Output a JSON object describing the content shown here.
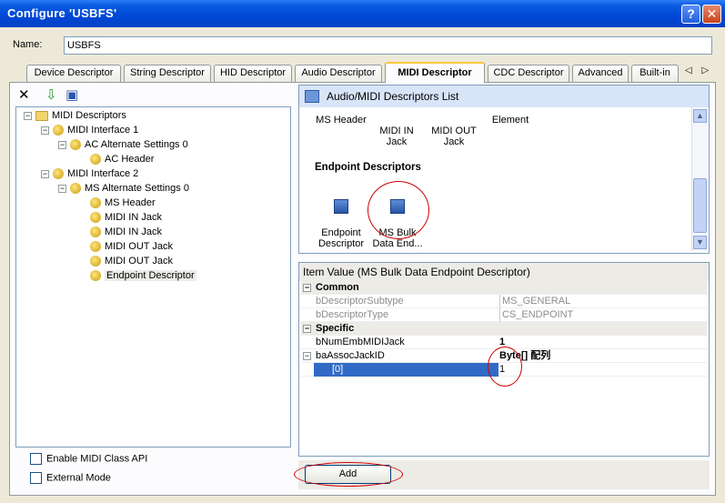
{
  "window": {
    "title": "Configure 'USBFS'",
    "help": "?",
    "close": "✕"
  },
  "name": {
    "label": "Name:",
    "value": "USBFS"
  },
  "tabs": [
    "Device Descriptor",
    "String Descriptor",
    "HID Descriptor",
    "Audio Descriptor",
    "MIDI Descriptor",
    "CDC Descriptor",
    "Advanced",
    "Built-in"
  ],
  "tab_arrows": "◁ ▷",
  "tree": {
    "nodes": [
      {
        "label": "MIDI Descriptors",
        "exp": "−"
      },
      {
        "label": "MIDI Interface 1",
        "exp": "−"
      },
      {
        "label": "AC Alternate Settings 0",
        "exp": "−"
      },
      {
        "label": "AC Header"
      },
      {
        "label": "MIDI Interface 2",
        "exp": "−"
      },
      {
        "label": "MS Alternate Settings 0",
        "exp": "−"
      },
      {
        "label": "MS Header"
      },
      {
        "label": "MIDI IN Jack"
      },
      {
        "label": "MIDI IN Jack"
      },
      {
        "label": "MIDI OUT Jack"
      },
      {
        "label": "MIDI OUT Jack"
      },
      {
        "label": "Endpoint Descriptor"
      }
    ]
  },
  "options": {
    "enable_midi_class_api": "Enable MIDI Class API",
    "external_mode": "External Mode"
  },
  "descriptors_list": {
    "title": "Audio/MIDI Descriptors List",
    "items_row1": [
      "MS Header",
      "MIDI IN\nJack",
      "MIDI OUT\nJack",
      "Element"
    ],
    "section": "Endpoint Descriptors",
    "items_row2": [
      "Endpoint\nDescriptor",
      "MS Bulk\nData End..."
    ]
  },
  "item_value": {
    "title": "Item Value (MS Bulk Data Endpoint Descriptor)",
    "rows": [
      {
        "k": "Common",
        "v": ""
      },
      {
        "k": "bDescriptorSubtype",
        "v": "MS_GENERAL"
      },
      {
        "k": "bDescriptorType",
        "v": "CS_ENDPOINT"
      },
      {
        "k": "Specific",
        "v": ""
      },
      {
        "k": "bNumEmbMIDIJack",
        "v": "1"
      },
      {
        "k": "baAssocJackID",
        "v": "Byte[] 配列"
      },
      {
        "k": "[0]",
        "v": "1"
      }
    ]
  },
  "add_button": "Add"
}
